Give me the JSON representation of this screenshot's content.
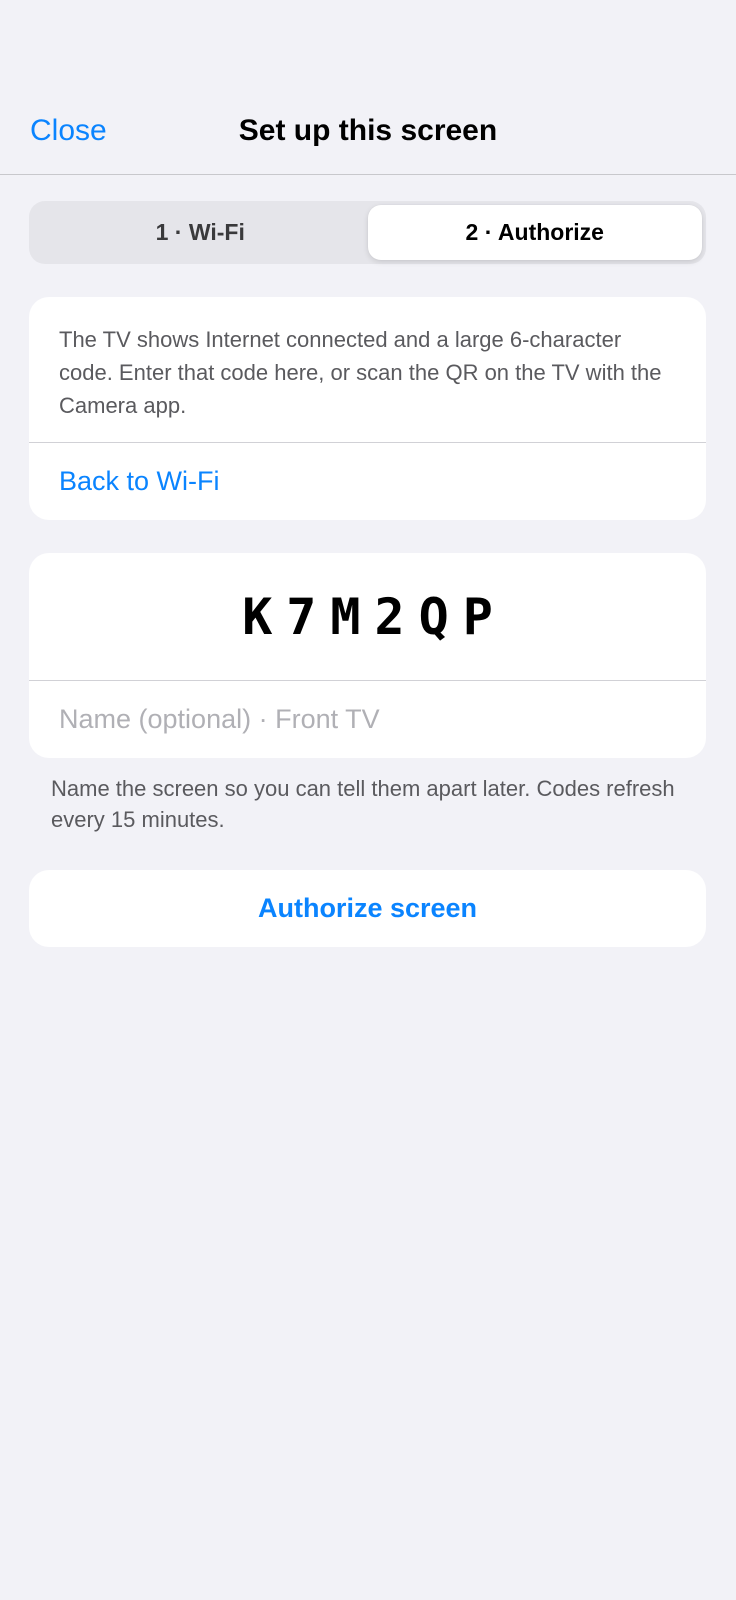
{
  "nav": {
    "close_label": "Close",
    "title": "Set up this screen"
  },
  "steps": [
    {
      "label": "1 · Wi-Fi",
      "active": false
    },
    {
      "label": "2 · Authorize",
      "active": true
    }
  ],
  "info": {
    "text": "The TV shows Internet connected and a large 6-character code. Enter that code here, or scan the QR on the TV with the Camera app.",
    "back_label": "Back to Wi-Fi"
  },
  "form": {
    "code_value": "K7M2QP",
    "name_placeholder": "Name (optional) · Front TV",
    "name_value": ""
  },
  "footnote": "Name the screen so you can tell them apart later. Codes refresh every 15 minutes.",
  "action": {
    "authorize_label": "Authorize screen"
  },
  "colors": {
    "accent": "#0a84ff",
    "background": "#f2f2f7"
  }
}
